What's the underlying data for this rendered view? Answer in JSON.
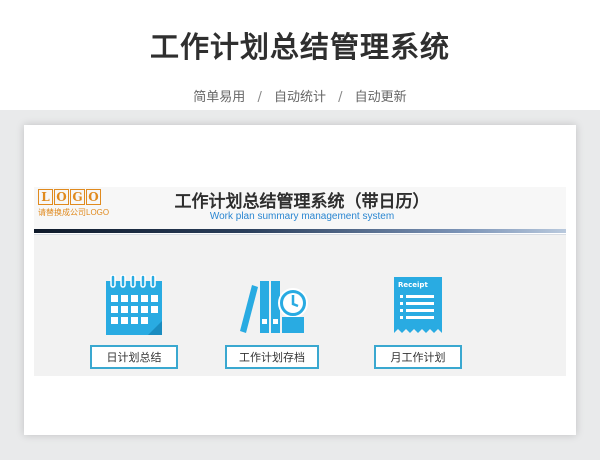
{
  "page": {
    "title": "工作计划总结管理系统",
    "tagline": [
      "简单易用",
      "自动统计",
      "自动更新"
    ],
    "tagline_separator": "/"
  },
  "header": {
    "logo_letters": [
      "L",
      "O",
      "G",
      "O"
    ],
    "logo_caption": "请替换成公司LOGO",
    "system_title": "工作计划总结管理系统（带日历）",
    "system_subtitle": "Work plan summary management system"
  },
  "tiles": [
    {
      "icon": "calendar-icon",
      "label": "日计划总结"
    },
    {
      "icon": "archive-binders-clock-icon",
      "label": "工作计划存档"
    },
    {
      "icon": "receipt-icon",
      "label": "月工作计划",
      "icon_text": "Receipt"
    }
  ],
  "colors": {
    "accent": "#29abe2",
    "button_border": "#3aa8d0",
    "logo": "#e08a1e",
    "subtitle_blue": "#2a86d1"
  }
}
